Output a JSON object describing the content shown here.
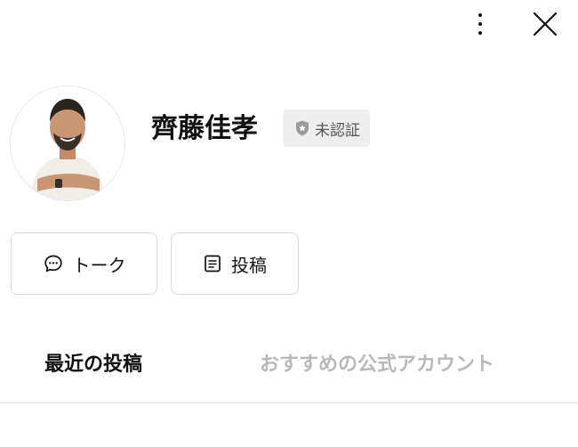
{
  "header": {
    "more_icon": "more-vertical-icon",
    "close_icon": "close-icon"
  },
  "profile": {
    "name": "齊藤佳孝",
    "badge_icon": "shield-star-icon",
    "badge_text": "未認証"
  },
  "actions": {
    "talk": {
      "icon": "chat-bubble-icon",
      "label": "トーク"
    },
    "posts": {
      "icon": "document-icon",
      "label": "投稿"
    }
  },
  "tabs": [
    {
      "label": "最近の投稿",
      "active": true
    },
    {
      "label": "おすすめの公式アカウント",
      "active": false
    }
  ],
  "colors": {
    "text": "#111111",
    "inactive_tab": "#b9b9b9",
    "badge_bg": "#eeeeee",
    "border": "#d9d9d9"
  }
}
